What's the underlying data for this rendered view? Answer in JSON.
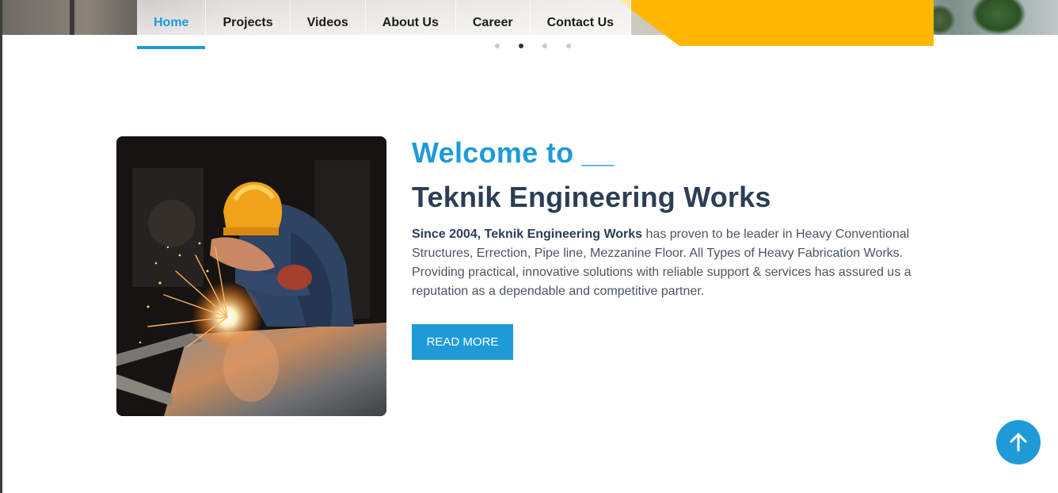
{
  "nav": {
    "items": [
      {
        "label": "Home",
        "active": true
      },
      {
        "label": "Projects"
      },
      {
        "label": "Videos"
      },
      {
        "label": "About Us"
      },
      {
        "label": "Career"
      },
      {
        "label": "Contact Us"
      }
    ],
    "slider_dots": 4,
    "active_dot": 2
  },
  "hero": {
    "welcome": "Welcome to __",
    "title": "Teknik Engineering Works",
    "description_bold": "Since 2004, Teknik Engineering Works",
    "description_rest": " has proven to be leader in Heavy Conventional Structures, Errection, Pipe line, Mezzanine Floor. All Types of Heavy Fabrication Works. Providing practical, innovative solutions with reliable support & services has assured us a reputation as a dependable and competitive partner.",
    "button_label": "READ MORE"
  },
  "colors": {
    "accent": "#1e9bd7",
    "heading": "#2c3e55",
    "yellow": "#ffb703"
  },
  "icons": {
    "scroll_top": "arrow-up-icon"
  }
}
